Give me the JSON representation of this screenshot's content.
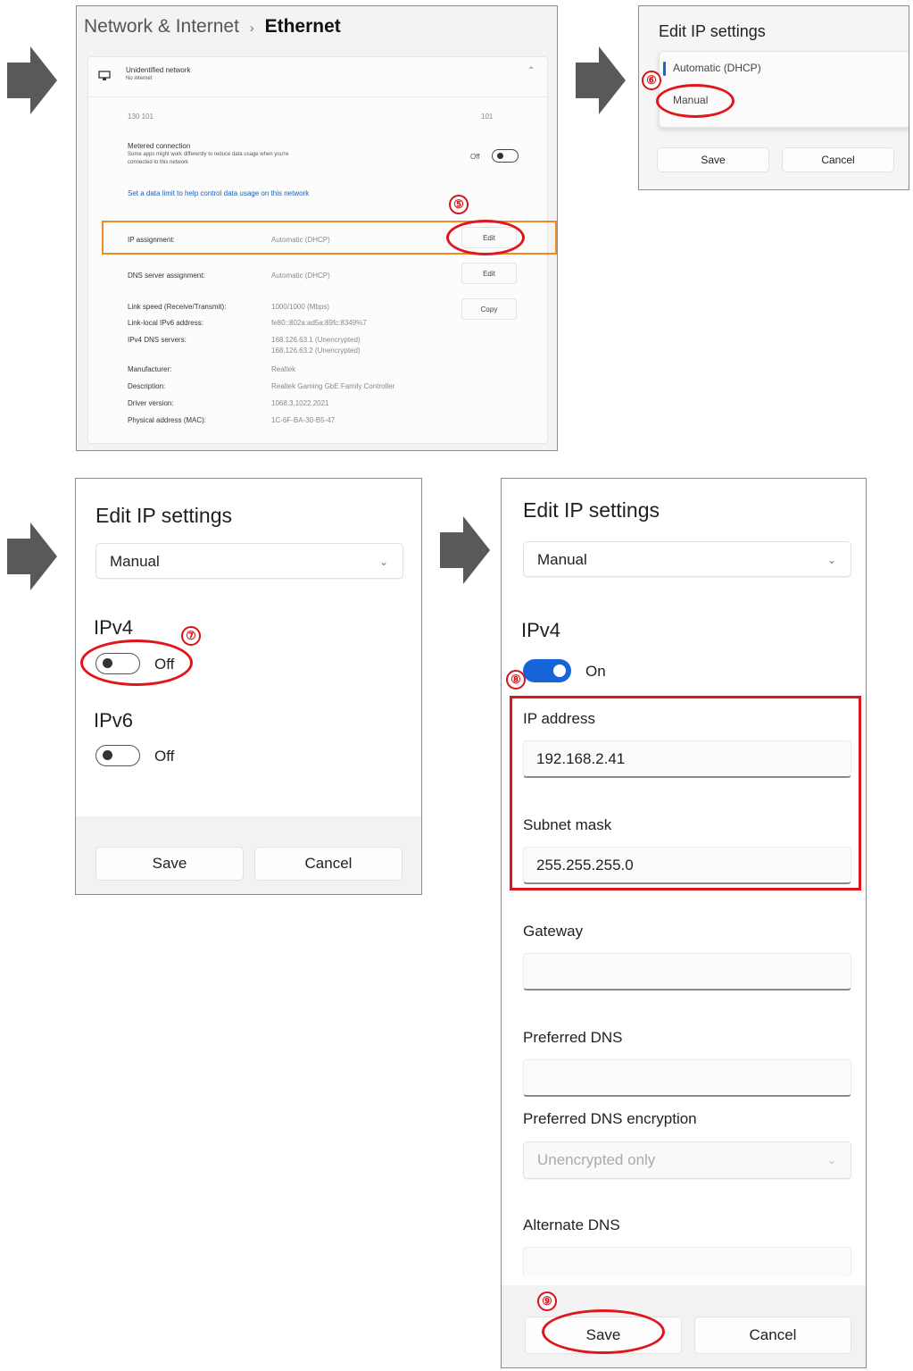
{
  "colors": {
    "accent": "#1565d8",
    "annotation_red": "#e0161c",
    "highlight_orange": "#f08a24",
    "arrow_gray": "#595959"
  },
  "panel1": {
    "breadcrumb_parent": "Network & Internet",
    "breadcrumb_sep": "›",
    "breadcrumb_current": "Ethernet",
    "network_name": "Unidentified network",
    "network_status": "No internet",
    "network_icon": "ethernet-icon",
    "profile_left": "130 101",
    "profile_right": "101",
    "metered_title": "Metered connection",
    "metered_desc_1": "Some apps might work differently to reduce data usage when you're",
    "metered_desc_2": "connected to this network",
    "metered_toggle": "Off",
    "data_limit_link": "Set a data limit to help control data usage on this network",
    "ip_assignment_label": "IP assignment:",
    "ip_assignment_value": "Automatic (DHCP)",
    "ip_edit": "Edit",
    "dns_label": "DNS server assignment:",
    "dns_value": "Automatic (DHCP)",
    "dns_edit": "Edit",
    "copy": "Copy",
    "props": [
      {
        "k": "Link speed (Receive/Transmit):",
        "v": "1000/1000 (Mbps)"
      },
      {
        "k": "Link-local IPv6 address:",
        "v": "fe80::802a:ad5a:89fc:8349%7"
      },
      {
        "k": "IPv4 DNS servers:",
        "v": "168.126.63.1 (Unencrypted)"
      },
      {
        "k": "",
        "v": "168.126.63.2 (Unencrypted)"
      },
      {
        "k": "Manufacturer:",
        "v": "Realtek"
      },
      {
        "k": "Description:",
        "v": "Realtek Gaming GbE Family Controller"
      },
      {
        "k": "Driver version:",
        "v": "1068.3.1022.2021"
      },
      {
        "k": "Physical address (MAC):",
        "v": "1C-6F-BA-30-B5-47"
      }
    ]
  },
  "panel2": {
    "title": "Edit IP settings",
    "option_selected": "Automatic (DHCP)",
    "option_manual": "Manual",
    "save": "Save",
    "cancel": "Cancel"
  },
  "panel3": {
    "title": "Edit IP settings",
    "mode": "Manual",
    "ipv4_heading": "IPv4",
    "ipv4_state": "Off",
    "ipv6_heading": "IPv6",
    "ipv6_state": "Off",
    "save": "Save",
    "cancel": "Cancel"
  },
  "panel4": {
    "title": "Edit IP settings",
    "mode": "Manual",
    "ipv4_heading": "IPv4",
    "ipv4_state": "On",
    "ip_address_label": "IP address",
    "ip_address_value": "192.168.2.41",
    "subnet_label": "Subnet mask",
    "subnet_value": "255.255.255.0",
    "gateway_label": "Gateway",
    "gateway_value": "",
    "pref_dns_label": "Preferred DNS",
    "pref_dns_value": "",
    "pref_dns_enc_label": "Preferred DNS encryption",
    "pref_dns_enc_value": "Unencrypted only",
    "alt_dns_label": "Alternate DNS",
    "save": "Save",
    "cancel": "Cancel"
  },
  "steps": {
    "s5": "⑤",
    "s6": "⑥",
    "s7": "⑦",
    "s8": "⑧",
    "s9": "⑨"
  }
}
